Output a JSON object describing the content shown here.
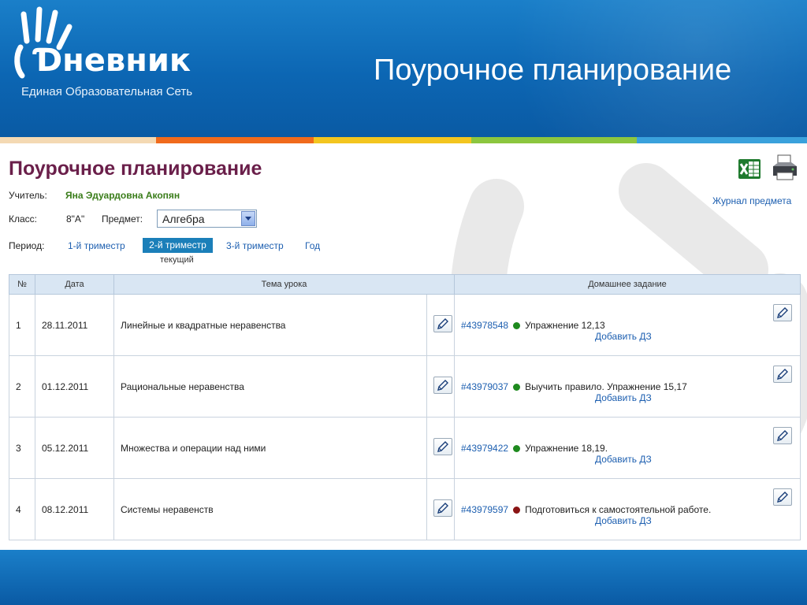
{
  "slide": {
    "logo_text": "Ɗневник",
    "logo_subtitle": "Единая Образовательная Сеть",
    "title": "Поурочное планирование",
    "colors": {
      "header_blue": "#0c66b3",
      "stripe": [
        "#f4d9b3",
        "#f2a533",
        "#f06a1c",
        "#f3c51f",
        "#8cc63f",
        "#3aa1dc"
      ]
    }
  },
  "page": {
    "title": "Поурочное планирование",
    "teacher_label": "Учитель:",
    "teacher_name": "Яна Эдуардовна Акопян",
    "class_label": "Класс:",
    "class_value": "8\"А\"",
    "subject_label": "Предмет:",
    "subject_value": "Алгебра",
    "period_label": "Период:",
    "periods": [
      "1-й триместр",
      "2-й триместр",
      "3-й триместр",
      "Год"
    ],
    "active_period": "2-й триместр",
    "current_label": "текущий",
    "journal_link": "Журнал предмета",
    "icons": {
      "excel": "excel-icon",
      "print": "printer-icon",
      "edit": "pencil-icon"
    }
  },
  "table": {
    "headers": [
      "№",
      "Дата",
      "Тема урока",
      "Домашнее задание"
    ],
    "add_hw_label": "Добавить ДЗ",
    "rows": [
      {
        "num": "1",
        "date": "28.11.2011",
        "topic": "Линейные и квадратные неравенства",
        "hw_id": "#43978548",
        "hw_status": "#1e8a1e",
        "hw_text": "Упражнение 12,13"
      },
      {
        "num": "2",
        "date": "01.12.2011",
        "topic": "Рациональные неравенства",
        "hw_id": "#43979037",
        "hw_status": "#1e8a1e",
        "hw_text": "Выучить правило. Упражнение 15,17"
      },
      {
        "num": "3",
        "date": "05.12.2011",
        "topic": "Множества и операции над ними",
        "hw_id": "#43979422",
        "hw_status": "#1e8a1e",
        "hw_text": "Упражнение 18,19."
      },
      {
        "num": "4",
        "date": "08.12.2011",
        "topic": "Системы неравенств",
        "hw_id": "#43979597",
        "hw_status": "#8a1414",
        "hw_text": "Подготовиться к самостоятельной работе."
      }
    ]
  }
}
